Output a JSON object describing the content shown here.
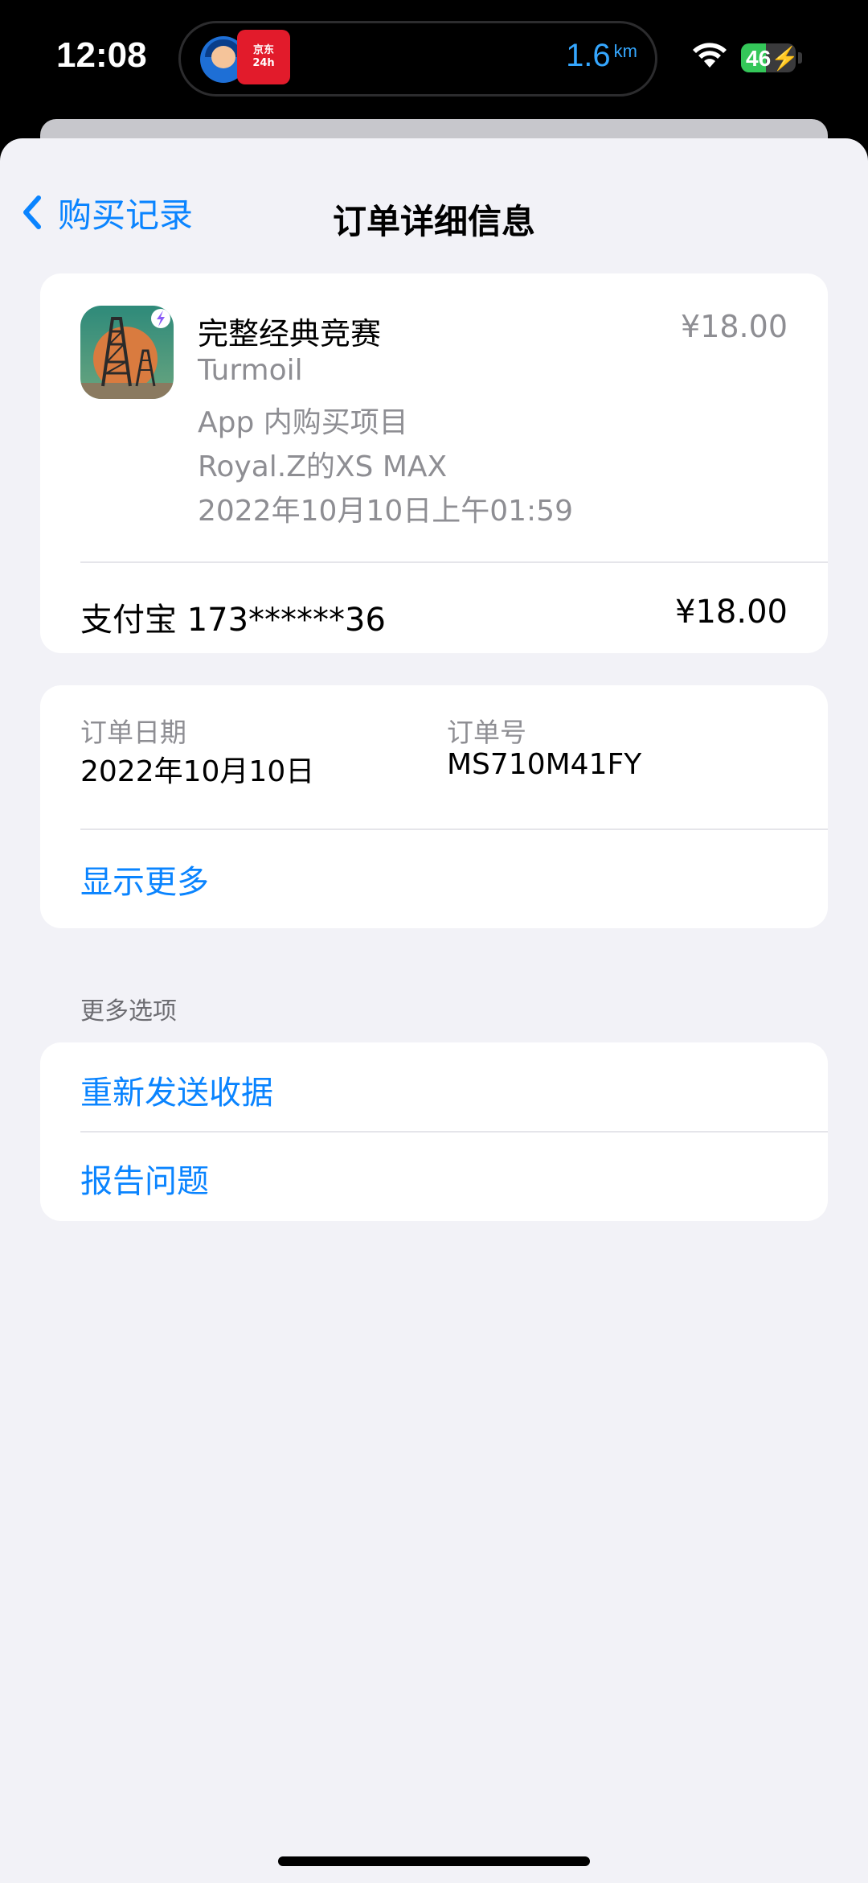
{
  "status_bar": {
    "time": "12:08",
    "live_activity": {
      "logo_text": "京东外卖 24h营业",
      "distance": "1.6",
      "distance_unit": "km"
    },
    "battery": {
      "level": "46",
      "percent": 46,
      "charging": true
    }
  },
  "nav": {
    "back_label": "购买记录",
    "title": "订单详细信息"
  },
  "product": {
    "icon": "oil-derrick-icon",
    "title": "完整经典竞赛",
    "price": "¥18.00",
    "app_name": "Turmoil",
    "type": "App 内购买项目",
    "device": "Royal.Z的XS MAX",
    "datetime": "2022年10月10日上午01:59"
  },
  "payment": {
    "method": "支付宝 173******36",
    "amount": "¥18.00"
  },
  "order": {
    "date_label": "订单日期",
    "date_value": "2022年10月10日",
    "id_label": "订单号",
    "id_value": "MS710M41FY",
    "show_more": "显示更多"
  },
  "more_options": {
    "header": "更多选项",
    "resend_receipt": "重新发送收据",
    "report_problem": "报告问题"
  },
  "colors": {
    "accent": "#0a84ff",
    "background": "#f2f2f7",
    "secondary_text": "#8e8e93",
    "battery_green": "#34c759"
  }
}
